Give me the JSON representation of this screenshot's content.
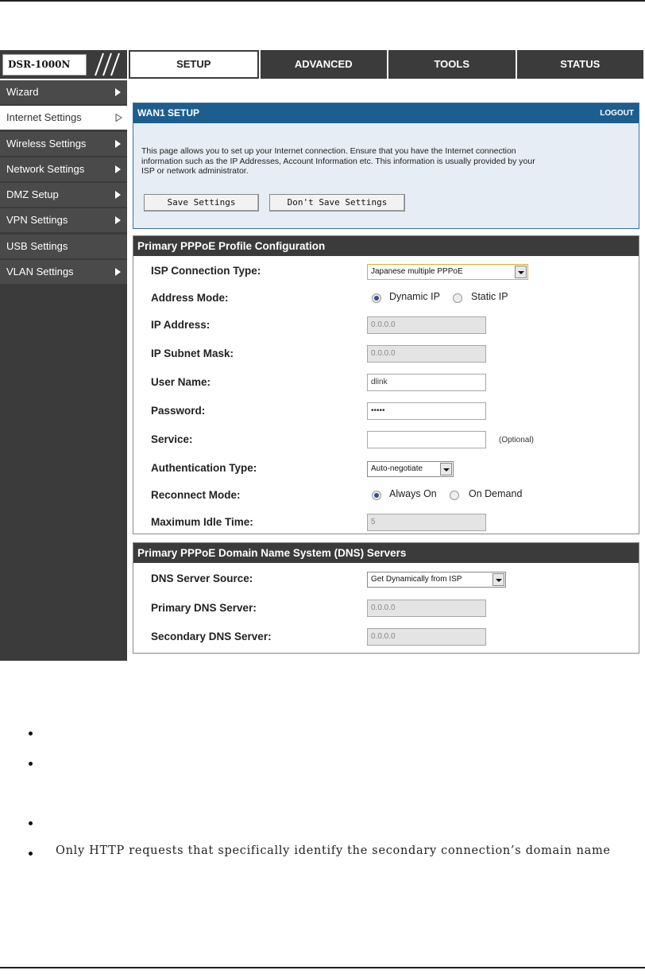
{
  "app": {
    "logo": "DSR-1000N"
  },
  "tabs": [
    {
      "label": "SETUP",
      "active": true
    },
    {
      "label": "ADVANCED",
      "active": false
    },
    {
      "label": "TOOLS",
      "active": false
    },
    {
      "label": "STATUS",
      "active": false
    }
  ],
  "sidebar": {
    "items": [
      {
        "label": "Wizard"
      },
      {
        "label": "Internet Settings"
      },
      {
        "label": "Wireless Settings"
      },
      {
        "label": "Network Settings"
      },
      {
        "label": "DMZ Setup"
      },
      {
        "label": "VPN Settings"
      },
      {
        "label": "USB Settings"
      },
      {
        "label": "VLAN Settings"
      }
    ]
  },
  "wan": {
    "title": "WAN1 SETUP",
    "logout": "LOGOUT",
    "description_line1": "This page allows you to set up your Internet connection. Ensure that you have the Internet connection",
    "description_line2": "information such as the IP Addresses, Account Information etc. This information is usually provided by your",
    "description_line3": "ISP or network administrator.",
    "save_label": "Save Settings",
    "dont_save_label": "Don't Save Settings"
  },
  "pppoe": {
    "title": "Primary PPPoE Profile Configuration",
    "isp_type_label": "ISP Connection Type:",
    "isp_type_value": "Japanese multiple PPPoE",
    "address_mode_label": "Address Mode:",
    "dynamic_ip": "Dynamic IP",
    "static_ip": "Static IP",
    "ip_address_label": "IP Address:",
    "ip_address_value": "0.0.0.0",
    "subnet_label": "IP Subnet Mask:",
    "subnet_value": "0.0.0.0",
    "username_label": "User Name:",
    "username_value": "dlink",
    "password_label": "Password:",
    "password_value": "•••••",
    "service_label": "Service:",
    "service_value": "",
    "optional": "(Optional)",
    "auth_label": "Authentication Type:",
    "auth_value": "Auto-negotiate",
    "reconnect_label": "Reconnect Mode:",
    "always_on": "Always On",
    "on_demand": "On Demand",
    "idle_label": "Maximum Idle Time:",
    "idle_value": "5"
  },
  "dns": {
    "title": "Primary PPPoE Domain Name System (DNS) Servers",
    "source_label": "DNS Server Source:",
    "source_value": "Get Dynamically from ISP",
    "primary_label": "Primary DNS Server:",
    "primary_value": "0.0.0.0",
    "secondary_label": "Secondary DNS Server:",
    "secondary_value": "0.0.0.0"
  },
  "doc": {
    "bullet_text": "Only HTTP requests that specifically identify the secondary connection’s domain name"
  }
}
